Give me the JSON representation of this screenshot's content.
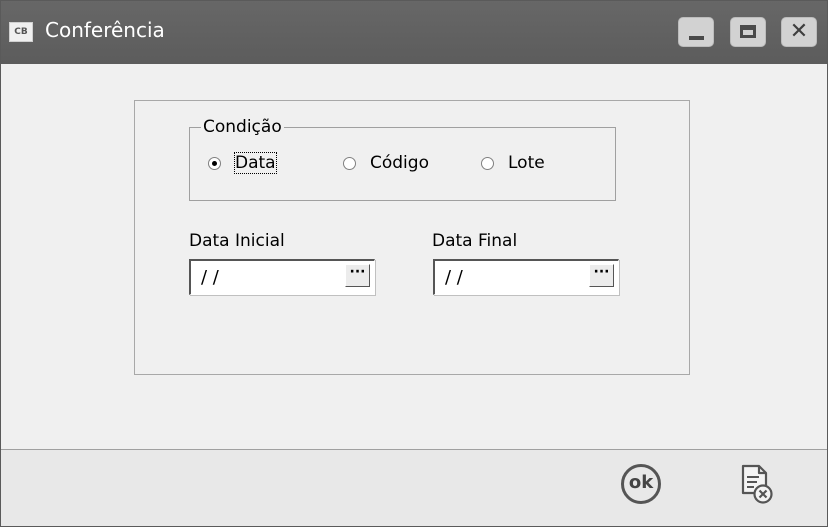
{
  "window": {
    "app_icon_text": "CB",
    "title": "Conferência"
  },
  "condition": {
    "legend": "Condição",
    "options": [
      {
        "label": "Data",
        "selected": true
      },
      {
        "label": "Código",
        "selected": false
      },
      {
        "label": "Lote",
        "selected": false
      }
    ]
  },
  "fields": {
    "start_label": "Data Inicial",
    "start_value": "/ /",
    "end_label": "Data Final",
    "end_value": "/ /",
    "browse_text": "···"
  },
  "footer": {
    "ok_label": "ok"
  },
  "icons": {
    "ok": "ok-circle-icon",
    "cancel": "document-cancel-icon",
    "minimize": "minimize-icon",
    "maximize": "maximize-icon",
    "close": "close-icon"
  }
}
